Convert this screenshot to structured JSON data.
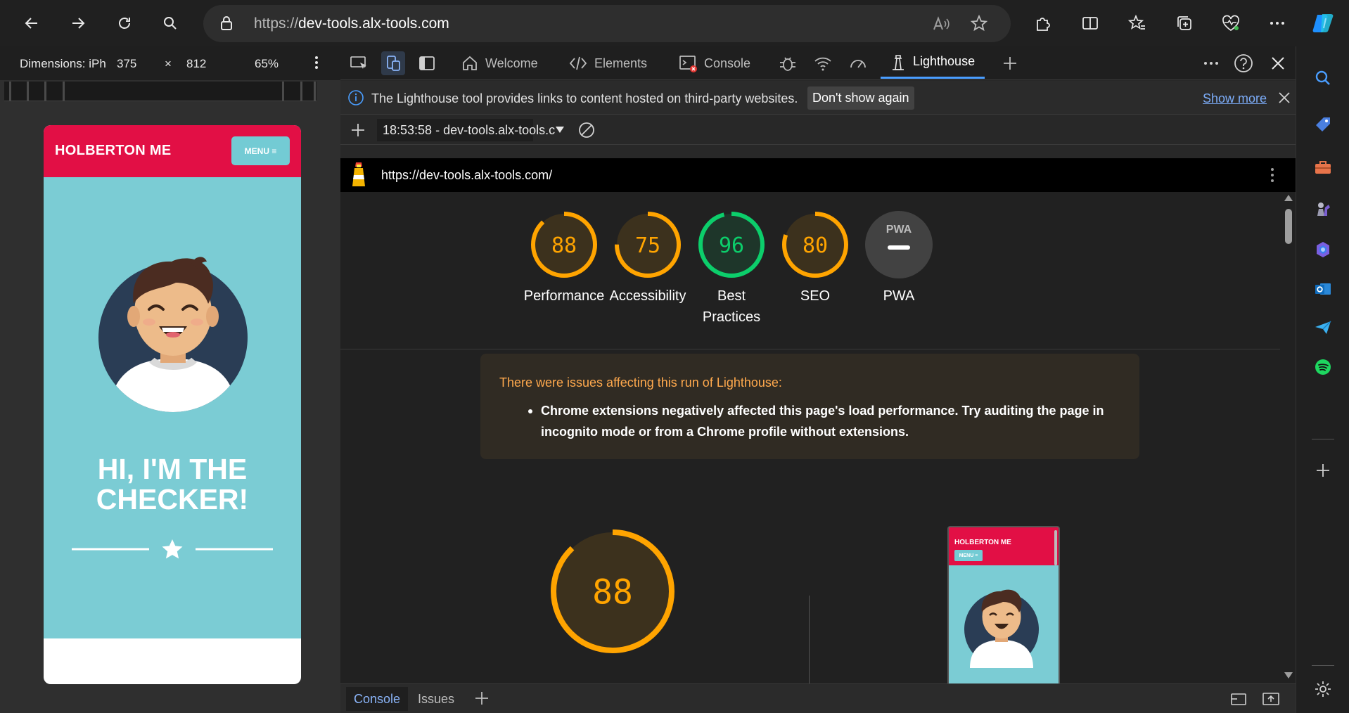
{
  "browser": {
    "url_proto": "https://",
    "url_host": "dev-tools.alx-tools.com"
  },
  "device_toolbar": {
    "dimensions_label": "Dimensions: iPh",
    "width": "375",
    "times": "×",
    "height": "812",
    "zoom": "65%"
  },
  "page": {
    "brand": "HOLBERTON ME",
    "menu_label": "MENU ≡",
    "hero_title_line1": "HI, I'M THE",
    "hero_title_line2": "CHECKER!"
  },
  "devtools": {
    "tabs": [
      {
        "label": "Welcome"
      },
      {
        "label": "Elements"
      },
      {
        "label": "Console"
      },
      {
        "label": "Lighthouse"
      }
    ],
    "info_text": "The Lighthouse tool provides links to content hosted on third-party websites.",
    "dont_show": "Don't show again",
    "show_more": "Show more",
    "run_label": "18:53:58 - dev-tools.alx-tools.c",
    "report_url": "https://dev-tools.alx-tools.com/"
  },
  "scores": [
    {
      "value": 88,
      "label": "Performance",
      "color": "#ffa400"
    },
    {
      "value": 75,
      "label": "Accessibility",
      "color": "#ffa400"
    },
    {
      "value": 96,
      "label": "Best Practices",
      "color": "#0cce6b"
    },
    {
      "value": 80,
      "label": "SEO",
      "color": "#ffa400"
    },
    {
      "value": null,
      "label": "PWA",
      "color": "#9e9e9e",
      "badge": "PWA"
    }
  ],
  "warning": {
    "title": "There were issues affecting this run of Lighthouse:",
    "item": "Chrome extensions negatively affected this page's load performance. Try auditing the page in incognito mode or from a Chrome profile without extensions."
  },
  "big_gauge": {
    "value": 88,
    "color": "#ffa400"
  },
  "thumbnail": {
    "brand": "HOLBERTON ME",
    "menu": "MENU ≡"
  },
  "drawer": {
    "tabs": [
      {
        "label": "Console"
      },
      {
        "label": "Issues"
      }
    ]
  }
}
